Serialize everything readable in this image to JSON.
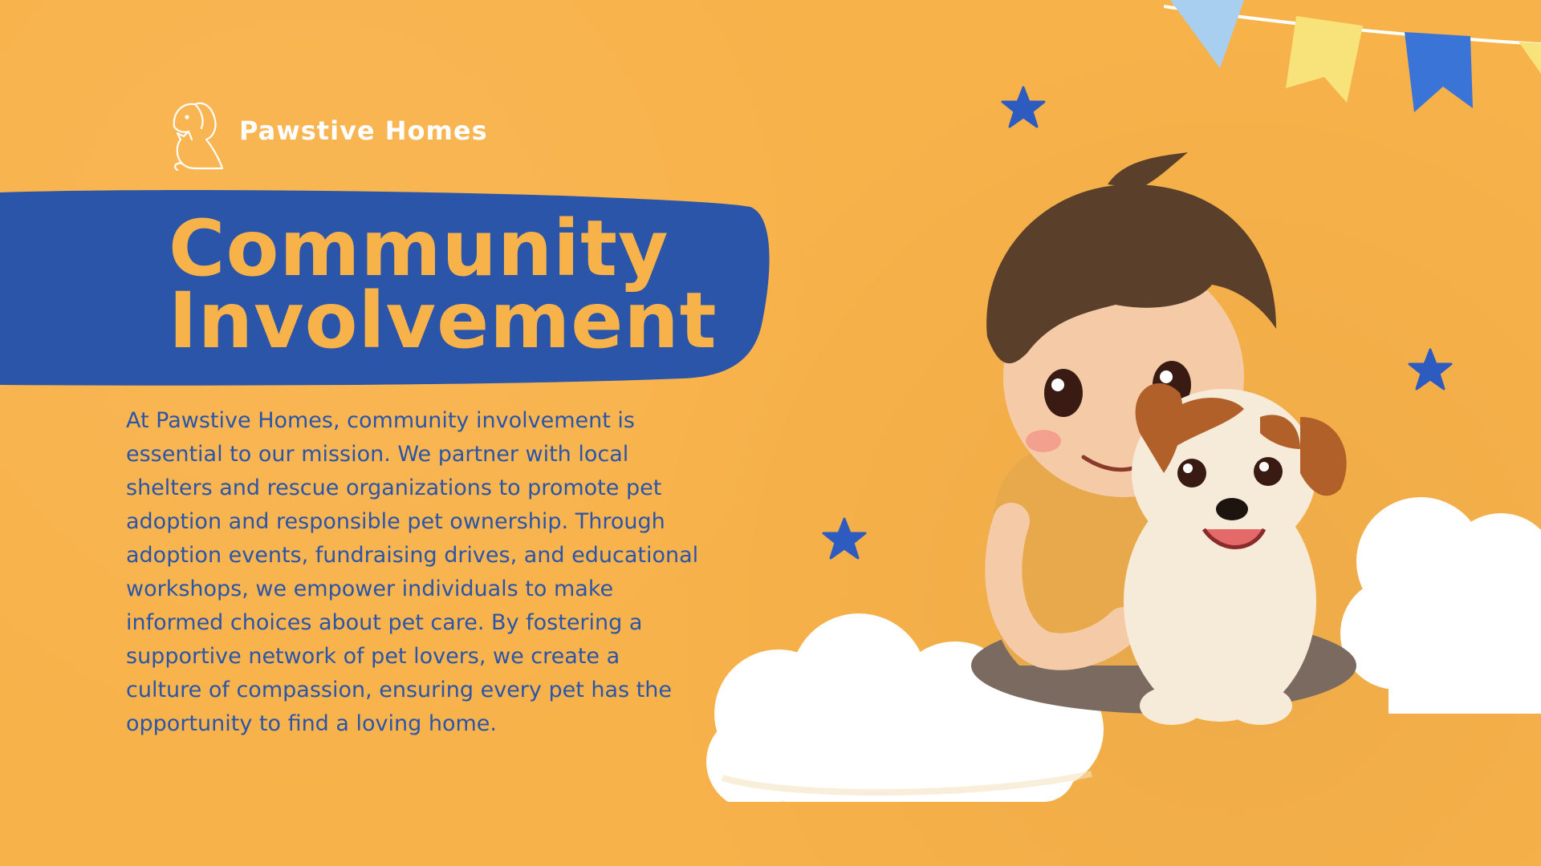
{
  "brand": {
    "name": "Pawstive Homes",
    "logo_icon": "dog-cat-outline-icon"
  },
  "title": {
    "line1": "Community",
    "line2": "Involvement"
  },
  "body": {
    "paragraph": "At Pawstive Homes, community involvement is essential to our mission. We partner with local shelters and rescue organizations to promote pet adoption and responsible pet ownership. Through adoption events, fundraising drives, and educational workshops, we empower individuals to make informed choices about pet care. By fostering a supportive network of pet lovers, we create a culture of compassion, ensuring every pet has the opportunity to find a loving home."
  },
  "colors": {
    "background": "#f8b24a",
    "banner_blue": "#2a55a8",
    "title_orange": "#f8b24a",
    "text_blue": "#2a55a8",
    "star_blue": "#2d5bbf",
    "cloud_white": "#ffffff"
  },
  "decorations": {
    "illustration": "boy-hugging-puppy-illustration",
    "stars": [
      "star-icon",
      "star-icon",
      "star-icon"
    ],
    "bunting": "bunting-flags"
  }
}
